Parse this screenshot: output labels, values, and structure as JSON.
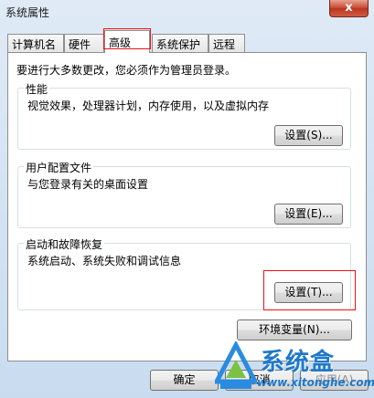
{
  "window": {
    "title": "系统属性",
    "close_label": "x"
  },
  "tabs": [
    {
      "label": "计算机名"
    },
    {
      "label": "硬件"
    },
    {
      "label": "高级"
    },
    {
      "label": "系统保护"
    },
    {
      "label": "远程"
    }
  ],
  "active_tab": "高级",
  "note": "要进行大多数更改，您必须作为管理员登录。",
  "groups": {
    "performance": {
      "title": "性能",
      "desc": "视觉效果，处理器计划，内存使用，以及虚拟内存",
      "button": "设置(S)..."
    },
    "profiles": {
      "title": "用户配置文件",
      "desc": "与您登录有关的桌面设置",
      "button": "设置(E)..."
    },
    "startup": {
      "title": "启动和故障恢复",
      "desc": "系统启动、系统失败和调试信息",
      "button": "设置(T)..."
    }
  },
  "env_button": "环境变量(N)...",
  "footer": {
    "ok": "确定",
    "cancel": "取消",
    "apply": "应用(A)"
  },
  "watermark": {
    "text": "系统盒",
    "url": "www.xitonghe.com"
  },
  "colors": {
    "highlight_border": "#ee1111",
    "watermark_blue": "#1f78c9"
  }
}
